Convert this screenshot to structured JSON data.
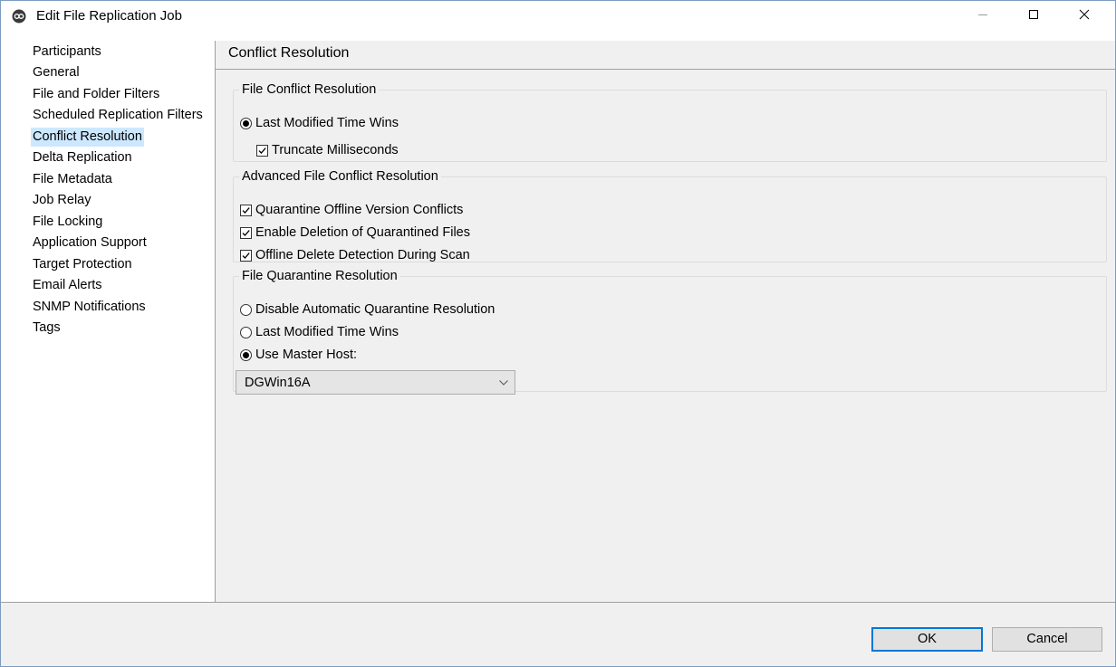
{
  "window": {
    "title": "Edit File Replication Job",
    "controls": {
      "minimize": "minimize",
      "maximize": "maximize",
      "close": "close"
    }
  },
  "sidebar": {
    "selected_index": 4,
    "items": [
      {
        "label": "Participants"
      },
      {
        "label": "General"
      },
      {
        "label": "File and Folder Filters"
      },
      {
        "label": "Scheduled Replication Filters"
      },
      {
        "label": "Conflict Resolution"
      },
      {
        "label": "Delta Replication"
      },
      {
        "label": "File Metadata"
      },
      {
        "label": "Job Relay"
      },
      {
        "label": "File Locking"
      },
      {
        "label": "Application Support"
      },
      {
        "label": "Target Protection"
      },
      {
        "label": "Email Alerts"
      },
      {
        "label": "SNMP Notifications"
      },
      {
        "label": "Tags"
      }
    ]
  },
  "content": {
    "title": "Conflict Resolution",
    "file_conflict": {
      "legend": "File Conflict Resolution",
      "last_modified": {
        "label": "Last Modified Time Wins",
        "checked": true
      },
      "truncate_ms": {
        "label": "Truncate Milliseconds",
        "checked": true
      }
    },
    "advanced": {
      "legend": "Advanced File Conflict Resolution",
      "quarantine_offline": {
        "label": "Quarantine Offline Version Conflicts",
        "checked": true
      },
      "enable_deletion": {
        "label": "Enable Deletion of Quarantined Files",
        "checked": true
      },
      "offline_delete": {
        "label": "Offline Delete Detection During Scan",
        "checked": true
      }
    },
    "quarantine": {
      "legend": "File Quarantine Resolution",
      "disable_auto": {
        "label": "Disable Automatic Quarantine Resolution",
        "checked": false
      },
      "last_modified": {
        "label": "Last Modified Time Wins",
        "checked": false
      },
      "use_master": {
        "label": "Use Master Host:",
        "checked": true
      },
      "master_host": {
        "value": "DGWin16A"
      }
    }
  },
  "footer": {
    "ok": "OK",
    "cancel": "Cancel"
  },
  "colors": {
    "accent": "#0078d7",
    "selection": "#cce8ff",
    "panel": "#f0f0f0"
  },
  "icons": [
    "app-logo-icon",
    "minimize-icon",
    "maximize-icon",
    "close-icon",
    "chevron-down-icon",
    "checkmark-icon"
  ]
}
